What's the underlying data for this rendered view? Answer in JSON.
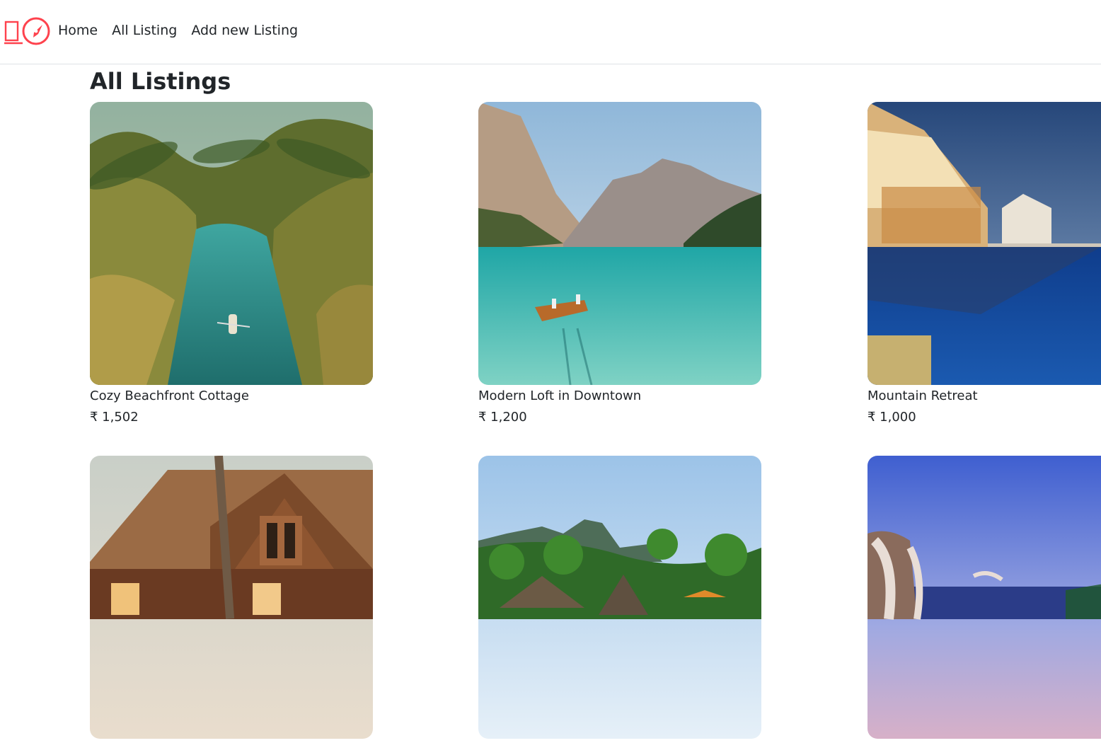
{
  "brand": {
    "icon": "compass-icon",
    "accent_color": "#fe424d"
  },
  "nav": {
    "items": [
      {
        "label": "Home"
      },
      {
        "label": "All Listing"
      },
      {
        "label": "Add new Listing"
      }
    ]
  },
  "main": {
    "title": "All Listings",
    "listings": [
      {
        "title": "Cozy Beachfront Cottage",
        "price": "₹ 1,502",
        "image": "palm-lagoon-kayak"
      },
      {
        "title": "Modern Loft in Downtown",
        "price": "₹ 1,200",
        "image": "mountain-lake-boat"
      },
      {
        "title": "Mountain Retreat",
        "price": "₹ 1,000",
        "image": "resort-pool-night"
      },
      {
        "title": "",
        "price": "",
        "image": "wooden-lodge-beach"
      },
      {
        "title": "",
        "price": "",
        "image": "tropical-huts-mountains"
      },
      {
        "title": "",
        "price": "",
        "image": "sunset-cabana-sea"
      }
    ]
  }
}
